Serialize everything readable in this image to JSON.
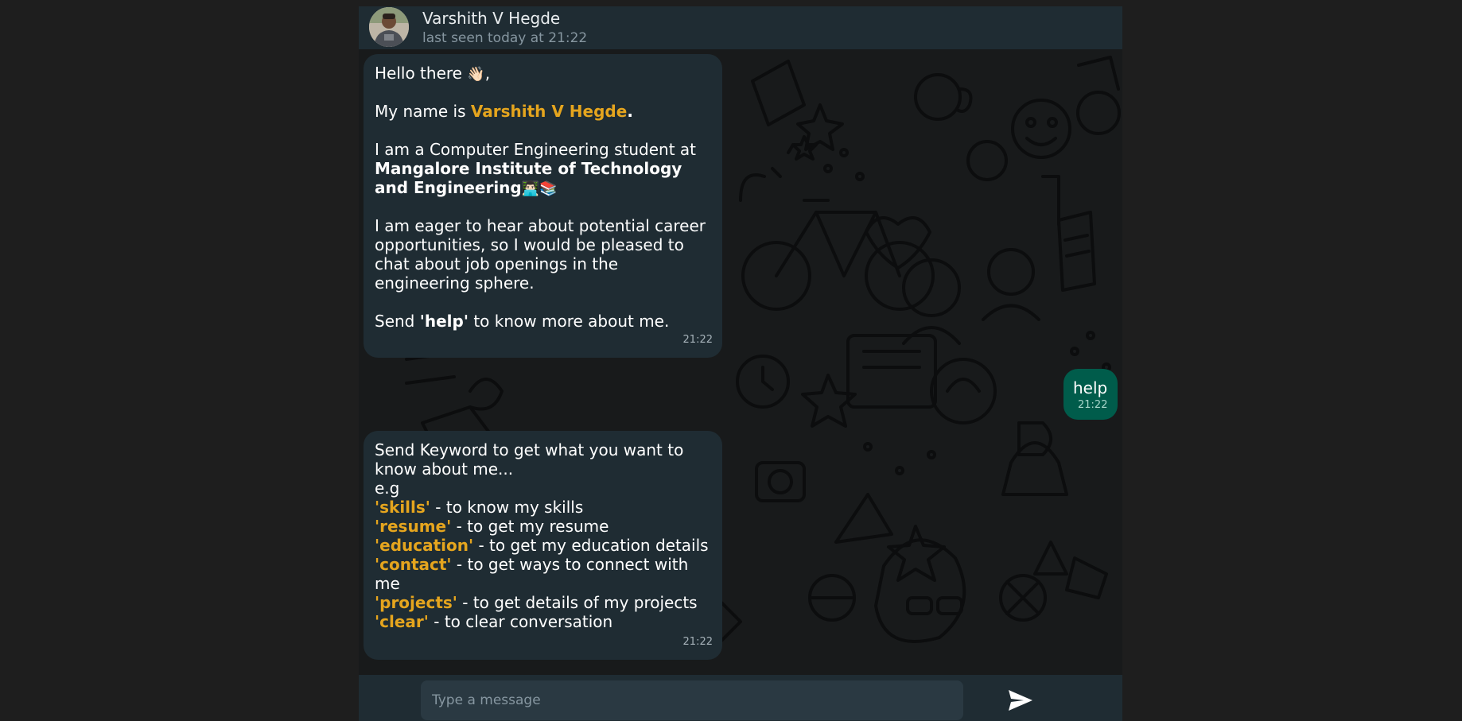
{
  "header": {
    "name": "Varshith V Hegde",
    "status": "last seen today at 21:22"
  },
  "messages": {
    "intro": {
      "greeting": "Hello there",
      "greeting_emoji": "👋🏻",
      "greeting_comma": ",",
      "name_prefix": "My name is ",
      "name": "Varshith V Hegde",
      "name_suffix": ".",
      "student_line": "I am a Computer Engineering student at",
      "college_line1": "Mangalore Institute of Technology",
      "college_line2": "and Engineering",
      "college_emoji": "👨🏻‍💻📚",
      "career_lines": [
        "I am eager to hear about potential career",
        "opportunities, so I would be pleased to",
        "chat about job openings in the",
        "engineering sphere."
      ],
      "send_prefix": "Send ",
      "send_kw": "'help'",
      "send_suffix": " to know more about me.",
      "time": "21:22"
    },
    "outgoing": {
      "text": "help",
      "time": "21:22"
    },
    "help": {
      "intro_lines": [
        "Send Keyword to get what you want to",
        "know about me...",
        "e.g"
      ],
      "keywords": [
        {
          "kw": "'skills'",
          "desc": " - to know my skills"
        },
        {
          "kw": "'resume'",
          "desc": " - to get my resume"
        },
        {
          "kw": "'education'",
          "desc": " - to get my education details"
        },
        {
          "kw": "'contact'",
          "desc": " - to get ways to connect with"
        },
        {
          "kw": "",
          "desc": "me"
        },
        {
          "kw": "'projects'",
          "desc": " - to get details of my projects"
        },
        {
          "kw": "'clear'",
          "desc": " - to clear conversation"
        }
      ],
      "time": "21:22"
    }
  },
  "composer": {
    "placeholder": "Type a message",
    "send_icon": "send-icon"
  },
  "colors": {
    "header": "#1f2c33",
    "incoming_bubble": "#1f2c33",
    "outgoing_bubble": "#005c4b",
    "highlight": "#e5a51e"
  }
}
